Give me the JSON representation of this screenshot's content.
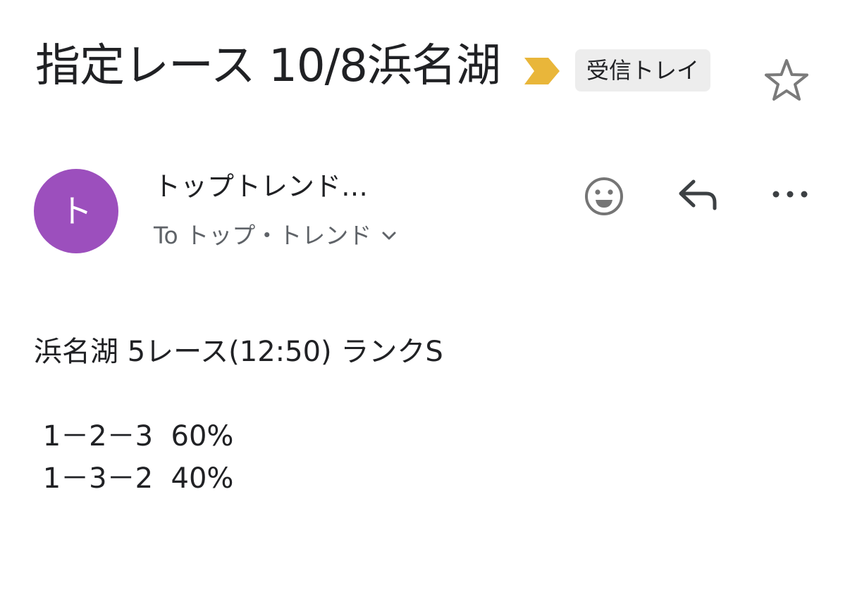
{
  "email": {
    "subject": "指定レース 10/8浜名湖",
    "label": "受信トレイ",
    "sender": {
      "avatar_initial": "ト",
      "name": "トップトレンド…",
      "recipients": "To トップ・トレンド"
    },
    "body": {
      "line1": "浜名湖 5レース(12:50) ランクS",
      "line2": " 1－2－3  60%",
      "line3": " 1－3－2  40%"
    }
  },
  "colors": {
    "avatar": "#9c4fbd",
    "importance_marker": "#e9b63a",
    "label_chip_bg": "#ededed"
  },
  "icons": [
    "importance-marker-icon",
    "star-icon",
    "emoji-icon",
    "reply-icon",
    "more-icon",
    "chevron-down-icon"
  ]
}
